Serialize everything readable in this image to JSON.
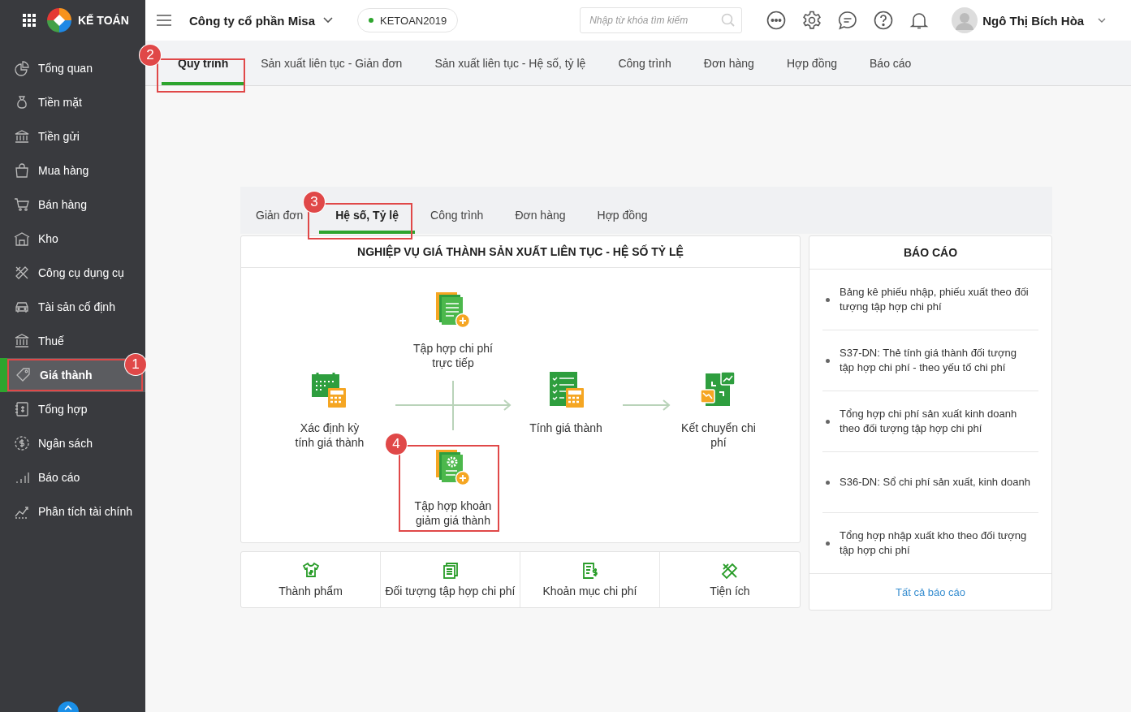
{
  "brand": {
    "name": "KẾ TOÁN"
  },
  "sidebar": {
    "items": [
      {
        "label": "Tổng quan",
        "selected": false
      },
      {
        "label": "Tiền mặt",
        "selected": false
      },
      {
        "label": "Tiền gửi",
        "selected": false
      },
      {
        "label": "Mua hàng",
        "selected": false
      },
      {
        "label": "Bán hàng",
        "selected": false
      },
      {
        "label": "Kho",
        "selected": false
      },
      {
        "label": "Công cụ dụng cụ",
        "selected": false
      },
      {
        "label": "Tài sản cố định",
        "selected": false
      },
      {
        "label": "Thuế",
        "selected": false
      },
      {
        "label": "Giá thành",
        "selected": true,
        "callout": "1"
      },
      {
        "label": "Tổng hợp",
        "selected": false
      },
      {
        "label": "Ngân sách",
        "selected": false
      },
      {
        "label": "Báo cáo",
        "selected": false
      },
      {
        "label": "Phân tích tài chính",
        "selected": false
      }
    ]
  },
  "topbar": {
    "company": "Công ty cổ phần Misa",
    "database": "KETOAN2019",
    "search": {
      "placeholder": "Nhập từ khóa tìm kiếm"
    },
    "user": "Ngô Thị Bích Hòa"
  },
  "tabs": [
    {
      "label": "Quy trình",
      "selected": true,
      "callout": "2"
    },
    {
      "label": "Sản xuất liên tục - Giản đơn",
      "selected": false
    },
    {
      "label": "Sản xuất liên tục - Hệ số, tỷ lệ",
      "selected": false
    },
    {
      "label": "Công trình",
      "selected": false
    },
    {
      "label": "Đơn hàng",
      "selected": false
    },
    {
      "label": "Hợp đồng",
      "selected": false
    },
    {
      "label": "Báo cáo",
      "selected": false
    }
  ],
  "sub_tabs": [
    {
      "label": "Giản đơn",
      "selected": false
    },
    {
      "label": "Hệ số, Tỷ lệ",
      "selected": true,
      "callout": "3"
    },
    {
      "label": "Công trình",
      "selected": false
    },
    {
      "label": "Đơn hàng",
      "selected": false
    },
    {
      "label": "Hợp đồng",
      "selected": false
    }
  ],
  "process": {
    "title": "NGHIỆP VỤ GIÁ THÀNH SẢN XUẤT LIÊN TỤC - HỆ SỐ TỶ LỆ",
    "nodes": [
      {
        "label": "Tập hợp chi phí trực tiếp"
      },
      {
        "label": "Xác định kỳ tính giá thành"
      },
      {
        "label": "Tính giá thành"
      },
      {
        "label": "Kết chuyển chi phí"
      },
      {
        "label": "Tập hợp khoản giảm giá thành",
        "callout": "4"
      }
    ]
  },
  "shortcuts": [
    {
      "label": "Thành phẩm"
    },
    {
      "label": "Đối tượng tập hợp chi phí"
    },
    {
      "label": "Khoản mục chi phí"
    },
    {
      "label": "Tiện ích"
    }
  ],
  "reports": {
    "title": "BÁO CÁO",
    "items": [
      "Bảng kê phiếu nhập, phiếu xuất theo đối tượng tập hợp chi phí",
      "S37-DN: Thẻ tính giá thành đối tượng tập hợp chi phí - theo yếu tố chi phí",
      "Tổng hợp chi phí sản xuất kinh doanh theo đối tượng tập hợp chi phí",
      "S36-DN: Sổ chi phí sản xuất, kinh doanh",
      "Tổng hợp nhập xuất kho theo đối tượng tập hợp chi phí"
    ],
    "link": "Tất cả báo cáo"
  }
}
